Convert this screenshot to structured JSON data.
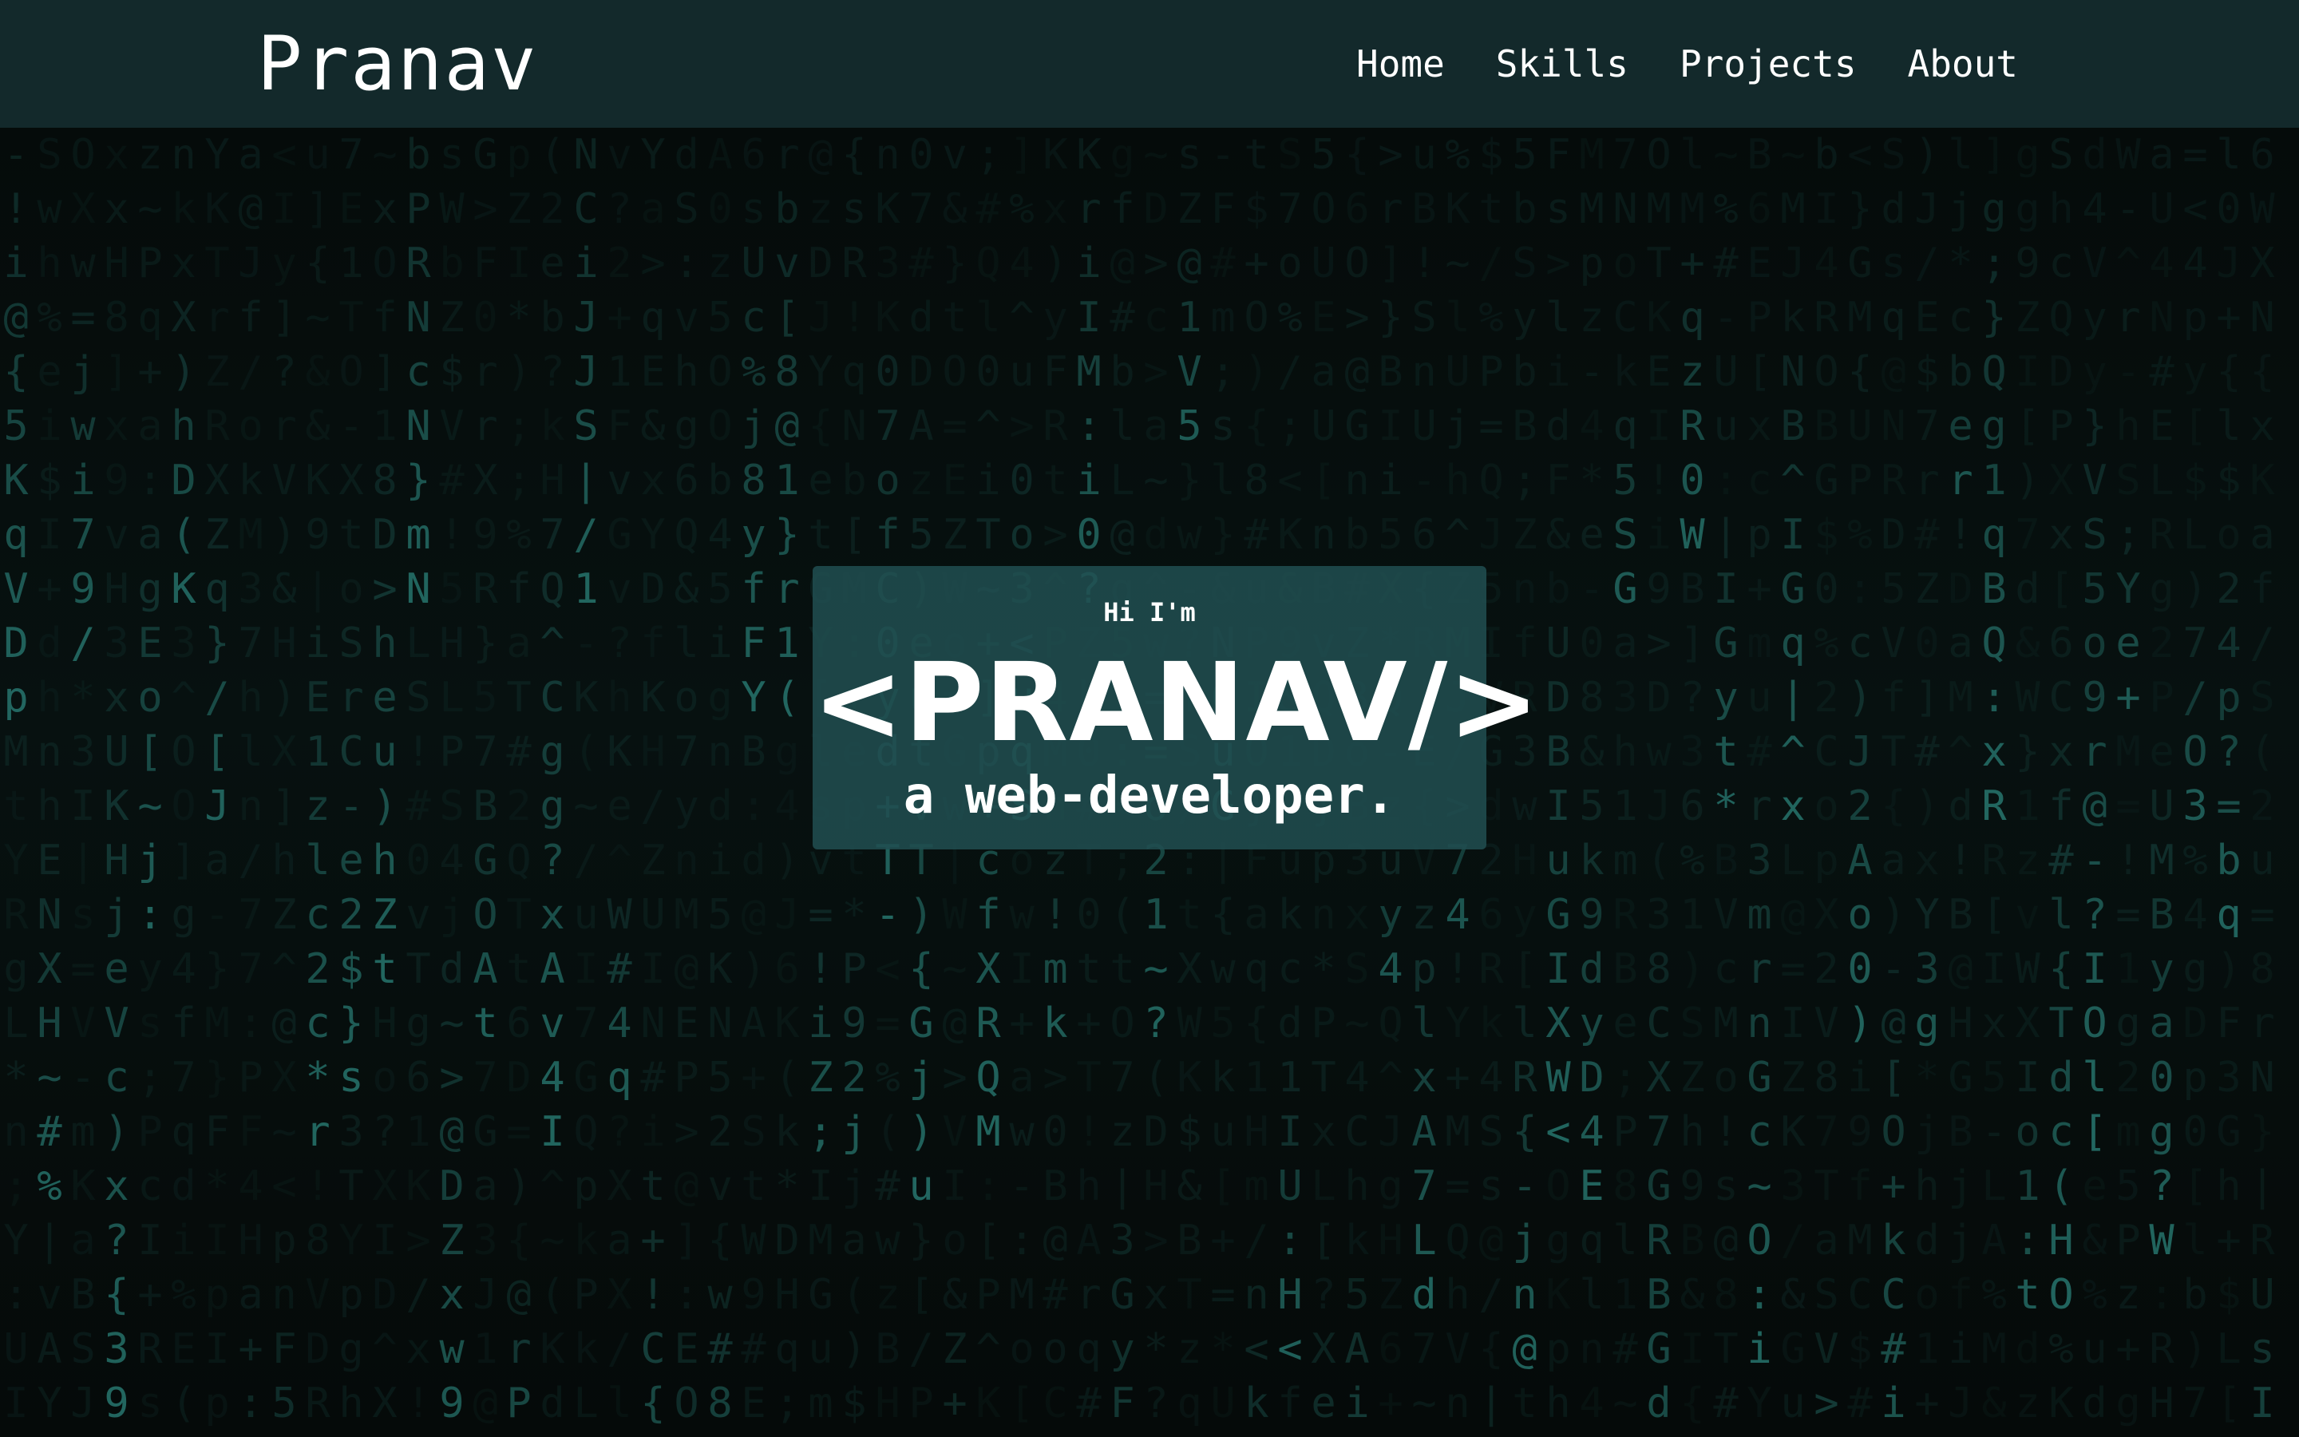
{
  "navbar": {
    "brand": "Pranav",
    "links": [
      {
        "label": "Home"
      },
      {
        "label": "Skills"
      },
      {
        "label": "Projects"
      },
      {
        "label": "About"
      }
    ]
  },
  "hero": {
    "greeting": "Hi I'm",
    "name": "<PRANAV/>",
    "role": "a web-developer."
  },
  "background": {
    "effect": "matrix-digital-rain",
    "glyph_color": "#2f8f86",
    "base_color": "#040807"
  },
  "colors": {
    "navbar_bg": "#13292b",
    "card_bg": "#214e50",
    "text": "#ffffff"
  }
}
